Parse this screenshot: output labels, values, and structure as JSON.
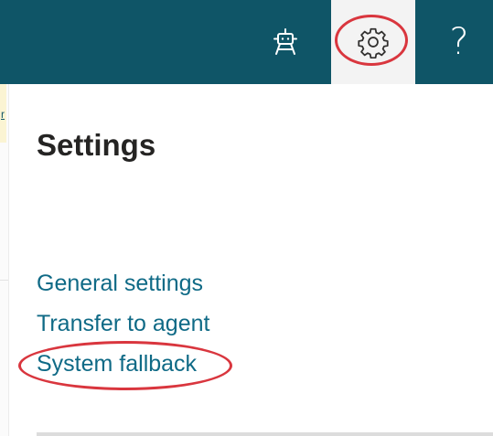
{
  "topbar": {
    "bot_icon": "bot-icon",
    "settings_icon": "gear-icon",
    "help_label": "?"
  },
  "left_strip": {
    "partial_text": "r"
  },
  "panel": {
    "title": "Settings",
    "items": [
      {
        "label": "General settings"
      },
      {
        "label": "Transfer to agent"
      },
      {
        "label": "System fallback"
      }
    ]
  },
  "colors": {
    "topbar": "#0f5567",
    "link": "#0f6a86",
    "annotation": "#d9363e",
    "active_tab": "#f3f3f3"
  }
}
